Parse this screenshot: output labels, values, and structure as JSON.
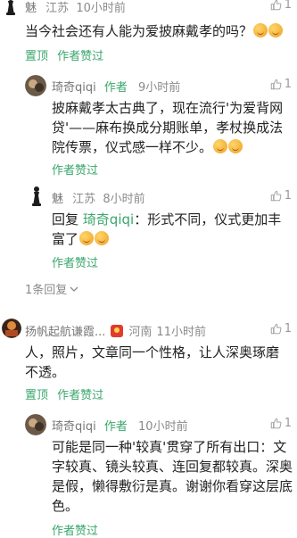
{
  "comments": {
    "c0": {
      "user": "魅",
      "location": "江苏",
      "time": "10小时前",
      "likes": "1",
      "text": "当今社会还有人能为爱披麻戴孝的吗？",
      "pin": "置顶",
      "author_liked": "作者赞过"
    },
    "r0": {
      "user": "琦奇qiqi",
      "tag": "作者",
      "time": "9小时前",
      "likes": "1",
      "text": "披麻戴孝太古典了，现在流行'为爱背网贷'——麻布换成分期账单，孝杖换成法院传票，仪式感一样不少。",
      "author_liked": "作者赞过"
    },
    "r1": {
      "user": "魅",
      "location": "江苏",
      "time": "8小时前",
      "likes": "1",
      "prefix": "回复",
      "mention": "琦奇qiqi",
      "text": "：形式不同，仪式更加丰富了",
      "author_liked": "作者赞过"
    },
    "collapse": "1条回复",
    "c1": {
      "user": "扬帆起航谦霞...",
      "location": "河南",
      "time": "11小时前",
      "likes": "1",
      "text": "人，照片，文章同一个性格，让人深奥琢磨不透。",
      "pin": "置顶",
      "author_liked": "作者赞过"
    },
    "r2": {
      "user": "琦奇qiqi",
      "tag": "作者",
      "time": "10小时前",
      "likes": "1",
      "text": "可能是同一种'较真'贯穿了所有出口：文字较真、镜头较真、连回复都较真。深奥是假，懒得敷衍是真。谢谢你看穿这层底色。",
      "author_liked": "作者赞过"
    }
  },
  "icons": {
    "thumb": "thumb-up-icon",
    "chevron": "chevron-down-icon",
    "emoji": "grimace-emoji-icon"
  },
  "colors": {
    "accent": "#3aa66b",
    "meta": "#8a8a8a"
  }
}
